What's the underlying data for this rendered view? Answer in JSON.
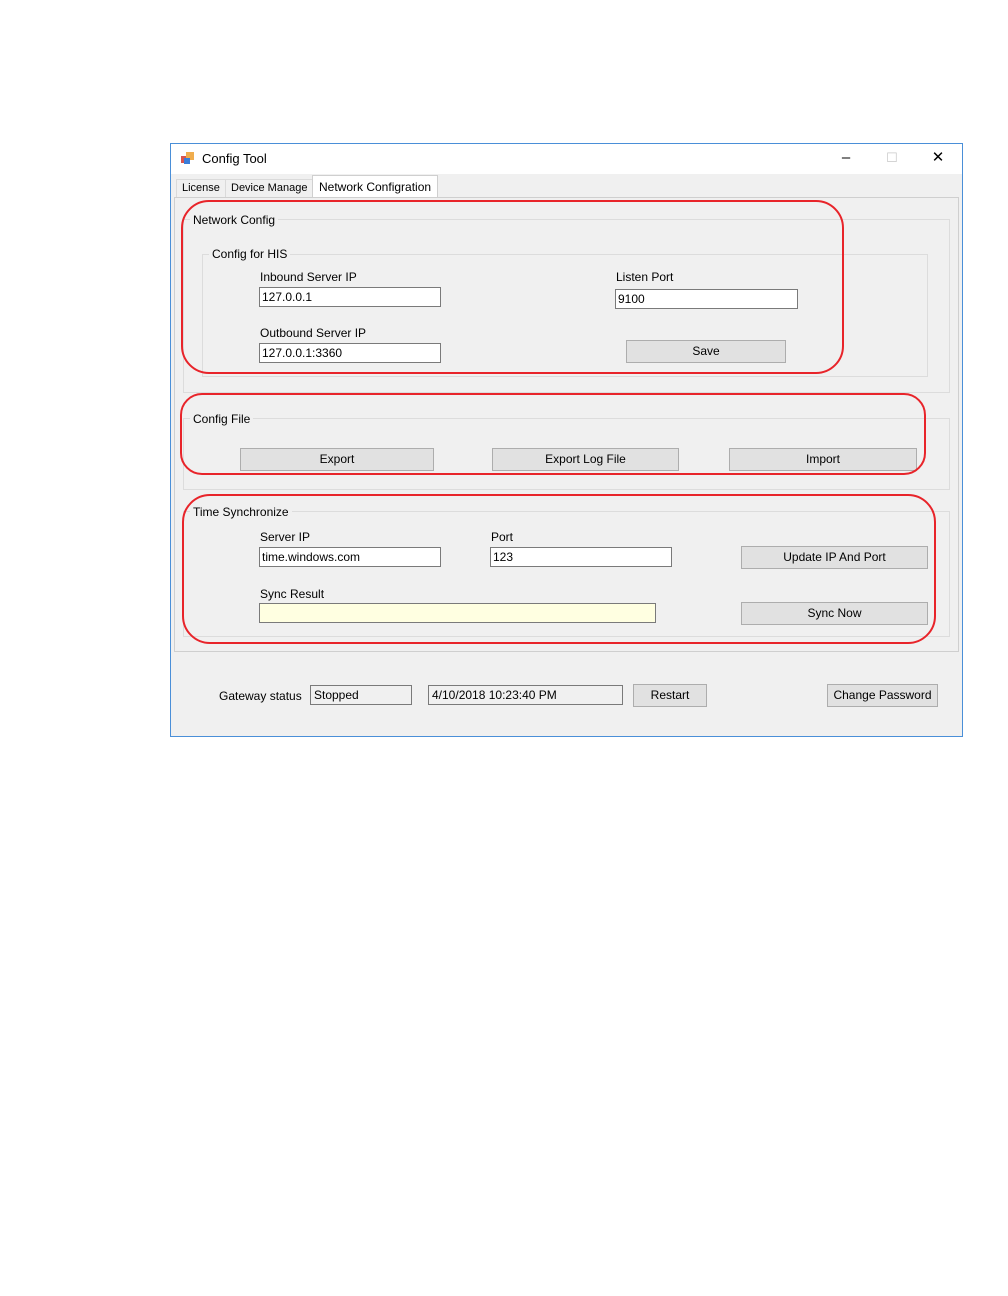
{
  "window": {
    "title": "Config Tool",
    "minimize": "–",
    "maximize": "☐",
    "close": "✕"
  },
  "tabs": [
    {
      "label": "License"
    },
    {
      "label": "Device Manage"
    },
    {
      "label": "Network Configration"
    }
  ],
  "network_config": {
    "title": "Network Config",
    "his_group": {
      "title": "Config for HIS",
      "inbound_label": "Inbound Server IP",
      "inbound_value": "127.0.0.1",
      "listen_port_label": "Listen Port",
      "listen_port_value": "9100",
      "outbound_label": "Outbound Server IP",
      "outbound_value": "127.0.0.1:3360",
      "save_label": "Save"
    }
  },
  "config_file": {
    "title": "Config File",
    "export_label": "Export",
    "export_log_label": "Export Log File",
    "import_label": "Import"
  },
  "time_sync": {
    "title": "Time Synchronize",
    "server_ip_label": "Server IP",
    "server_ip_value": "time.windows.com",
    "port_label": "Port",
    "port_value": "123",
    "update_label": "Update IP And Port",
    "sync_result_label": "Sync Result",
    "sync_result_value": "",
    "sync_now_label": "Sync Now"
  },
  "status_bar": {
    "gateway_label": "Gateway status",
    "gateway_value": "Stopped",
    "timestamp": "4/10/2018 10:23:40 PM",
    "restart_label": "Restart",
    "change_password_label": "Change Password"
  },
  "colors": {
    "window_border": "#4a8fd8",
    "annotation_red": "#e8242a",
    "sync_result_bg": "#ffffe1"
  }
}
